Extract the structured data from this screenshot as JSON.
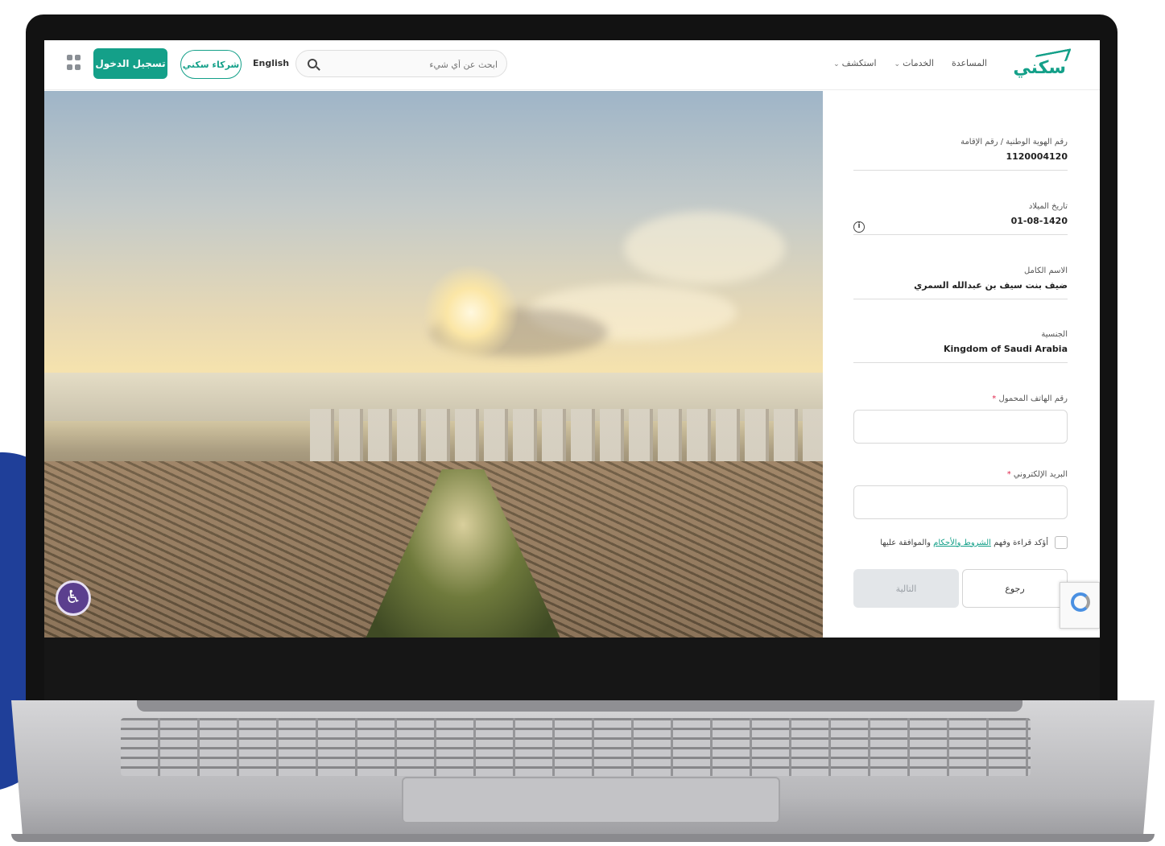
{
  "header": {
    "login_label": "تسجيل الدخول",
    "partner_label": "شركاء سكني",
    "language_label": "English",
    "search_placeholder": "ابحث عن أي شيء",
    "nav": [
      {
        "label": "استكشف",
        "has_dropdown": true
      },
      {
        "label": "الخدمات",
        "has_dropdown": true
      },
      {
        "label": "المساعدة",
        "has_dropdown": false
      }
    ],
    "logo_text": "سكني"
  },
  "form": {
    "id_label": "رقم الهوية الوطنية / رقم الإقامة",
    "id_value": "1120004120",
    "dob_label": "تاريخ الميلاد",
    "dob_value": "01-08-1420",
    "name_label": "الاسم الكامل",
    "name_value": "ضيف بنت سيف بن عبدالله السمري",
    "nationality_label": "الجنسية",
    "nationality_value": "Kingdom of Saudi Arabia",
    "phone_label": "رقم الهاتف المحمول",
    "email_label": "البريد الإلكتروني",
    "required_mark": "*",
    "agree_prefix": "أؤكد قراءة وفهم",
    "terms_link": "الشروط والأحكام",
    "agree_suffix": "والموافقة عليها",
    "back_label": "رجوع",
    "next_label": "التالية"
  },
  "colors": {
    "brand": "#14a089",
    "accessibility": "#5b3f8e",
    "accent_shape": "#1f3f99"
  },
  "icons": [
    "grid-icon",
    "search-icon",
    "chevron-down-icon",
    "info-icon",
    "accessibility-icon",
    "recaptcha-icon"
  ]
}
